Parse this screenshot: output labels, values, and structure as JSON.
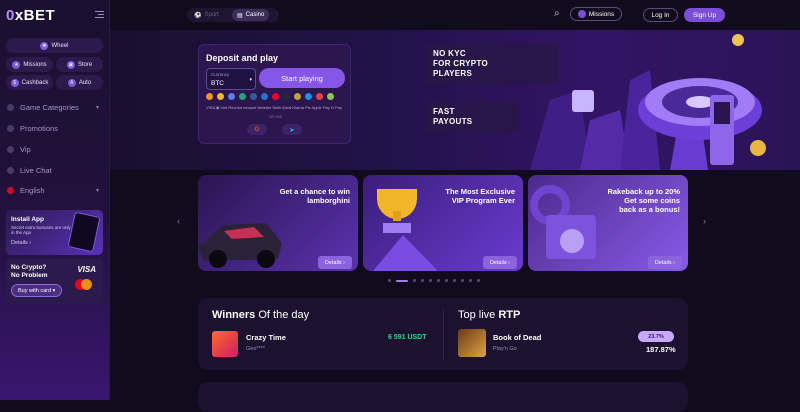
{
  "brand": {
    "logo_prefix": "0",
    "logo_text": "xBET",
    "accent": "#7b4dd9"
  },
  "sidebar": {
    "quick": [
      {
        "label": "Wheel",
        "icon": "wheel-icon"
      },
      {
        "label": "Missions",
        "icon": "missions-icon"
      },
      {
        "label": "Store",
        "icon": "store-icon"
      },
      {
        "label": "Cashback",
        "icon": "cashback-icon"
      },
      {
        "label": "Auto",
        "icon": "auto-icon"
      }
    ],
    "items": [
      {
        "label": "Game Categories"
      },
      {
        "label": "Promotions"
      },
      {
        "label": "Vip"
      },
      {
        "label": "Live Chat"
      },
      {
        "label": "English"
      }
    ],
    "install": {
      "title": "Install App",
      "text": "Secret extra bonuses are only in the App",
      "link": "Details ›"
    },
    "nocrypto": {
      "line1": "No Crypto?",
      "line2": "No Problem",
      "button": "Buy with card ▾",
      "visa": "VISA"
    }
  },
  "topnav": {
    "tabs": [
      "Sport",
      "Casino"
    ],
    "missions": "Missions",
    "login": "Log In",
    "signup": "Sign Up"
  },
  "hero": {
    "deposit": {
      "title": "Deposit and play",
      "currency_label": "Currency",
      "currency_value": "BTC",
      "button": "Start playing",
      "methods": "VISA ◉  Volt  Revolut  neosurf  Neteller  Skrill  iDeal  Klarna  Pix  Apple Pay  G Pay",
      "or_label": "OR USE"
    },
    "tag1": [
      "NO KYC",
      "FOR CRYPTO",
      "PLAYERS"
    ],
    "tag2": [
      "FAST",
      "PAYOUTS"
    ]
  },
  "promos": [
    {
      "title": "Get a chance to win\nlamborghini",
      "button": "Details ›"
    },
    {
      "title": "The Most Exclusive\nVIP Program Ever",
      "button": "Details ›"
    },
    {
      "title": "Rakeback up to 20%\nGet some coins\nback as a bonus!",
      "button": "Details ›"
    }
  ],
  "winners": {
    "title_bold": "Winners",
    "title_rest": "Of the day",
    "game": "Crazy Time",
    "user": "Geo****",
    "amount": "6 591 USDT"
  },
  "rtp": {
    "title_rest": "Top live",
    "title_bold": "RTP",
    "game": "Book of Dead",
    "provider": "Play'n Go",
    "badge": "23.7%",
    "value": "187.87%"
  }
}
